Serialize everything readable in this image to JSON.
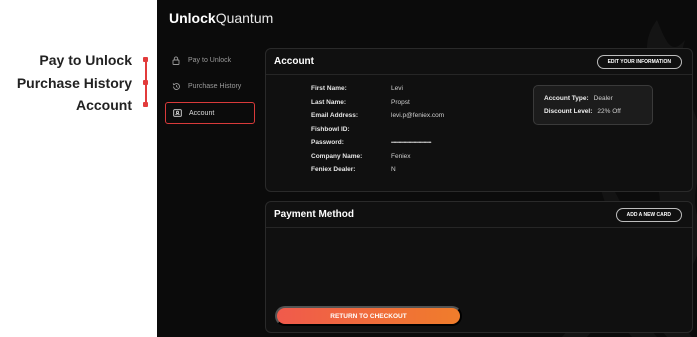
{
  "callouts": {
    "pay_to_unlock": "Pay to Unlock",
    "purchase_history": "Purchase History",
    "account": "Account",
    "accent": "#e23b3b"
  },
  "app": {
    "logo_bold": "Unlock",
    "logo_light": "Quantum"
  },
  "sidebar": {
    "items": [
      {
        "label": "Pay to Unlock",
        "icon": "lock-icon",
        "active": false
      },
      {
        "label": "Purchase History",
        "icon": "history-icon",
        "active": false
      },
      {
        "label": "Account",
        "icon": "id-card-icon",
        "active": true
      }
    ]
  },
  "account": {
    "title": "Account",
    "edit_button": "EDIT YOUR INFORMATION",
    "fields": [
      {
        "label": "First Name:",
        "value": "Levi"
      },
      {
        "label": "Last Name:",
        "value": "Propst"
      },
      {
        "label": "Email Address:",
        "value": "levi.p@feniex.com"
      },
      {
        "label": "Fishbowl ID:",
        "value": ""
      },
      {
        "label": "Password:",
        "value": "••••••••••••••••••••••••••••••••"
      },
      {
        "label": "Company Name:",
        "value": "Feniex"
      },
      {
        "label": "Feniex Dealer:",
        "value": "N"
      }
    ],
    "type_label": "Account Type:",
    "type_value": "Dealer",
    "discount_label": "Discount Level:",
    "discount_value": "22% Off"
  },
  "payment": {
    "title": "Payment Method",
    "add_button": "ADD A NEW CARD",
    "checkout_button": "RETURN TO CHECKOUT"
  },
  "colors": {
    "background": "#0b0b0b",
    "active_border": "#d93a3a",
    "checkout_start": "#f05a4c",
    "checkout_end": "#f07d2b"
  }
}
